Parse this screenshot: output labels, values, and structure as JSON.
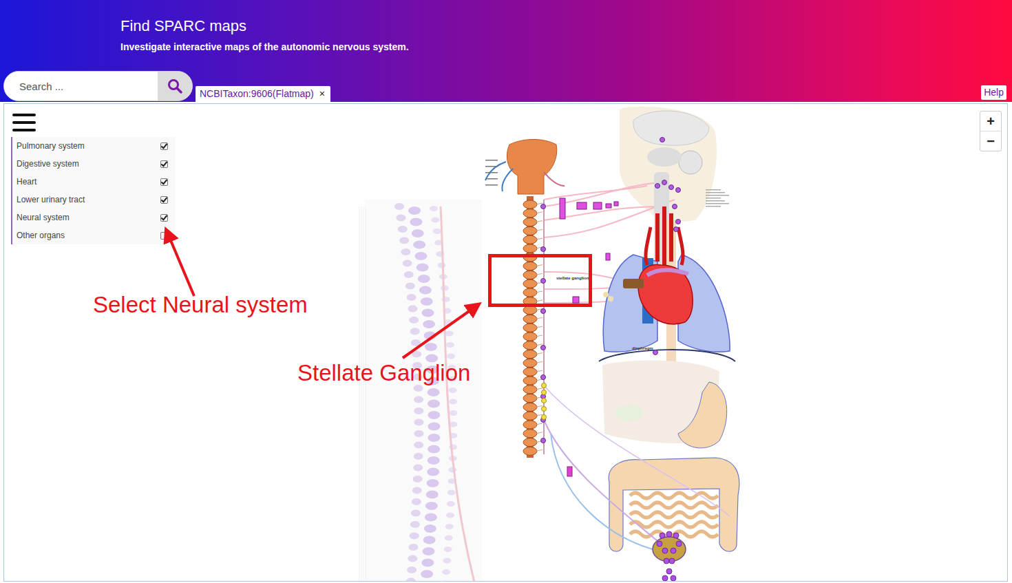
{
  "header": {
    "title": "Find SPARC maps",
    "subtitle": "Investigate interactive maps of the autonomic nervous system."
  },
  "search": {
    "placeholder": "Search ..."
  },
  "tabs": [
    {
      "label": "NCBITaxon:9606(Flatmap)",
      "close": "×",
      "selected": true
    }
  ],
  "help": "Help",
  "zoom": {
    "in": "+",
    "out": "−"
  },
  "layers": [
    {
      "label": "Pulmonary system",
      "checked": true
    },
    {
      "label": "Digestive system",
      "checked": true
    },
    {
      "label": "Heart",
      "checked": true
    },
    {
      "label": "Lower urinary tract",
      "checked": true
    },
    {
      "label": "Neural system",
      "checked": true
    },
    {
      "label": "Other organs",
      "checked": false
    }
  ],
  "map_labels": [
    "stellate ganglion",
    "diaphragm"
  ],
  "annotations": [
    {
      "text": "Select Neural system"
    },
    {
      "text": "Stellate Ganglion"
    }
  ]
}
